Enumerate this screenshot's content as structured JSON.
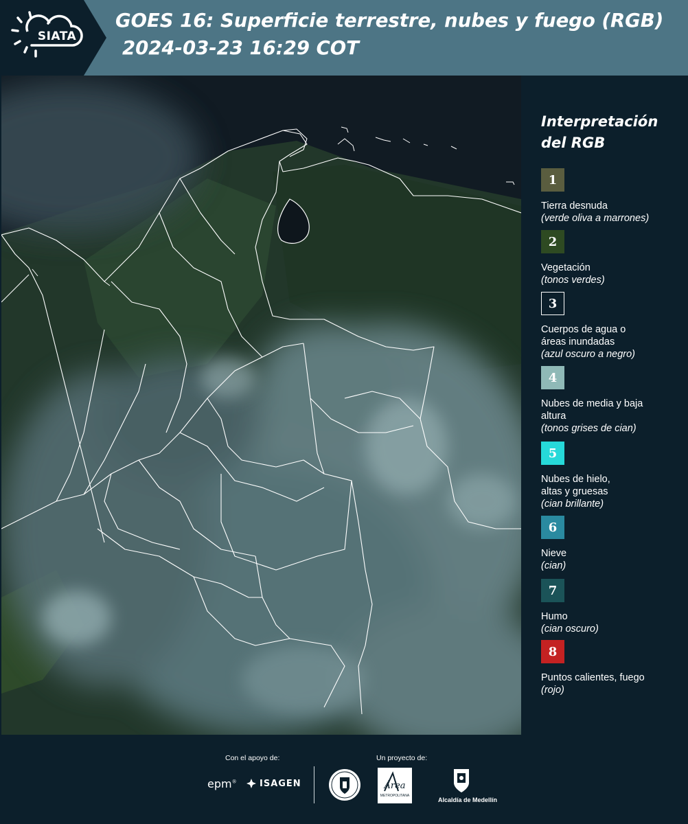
{
  "header": {
    "logo_text": "SIATA",
    "title_line1": "GOES 16: Superficie terrestre, nubes y fuego (RGB)",
    "title_line2": "2024-03-23 16:29 COT",
    "background_color": "#4d7585"
  },
  "legend": {
    "title_line1": "Interpretación",
    "title_line2": "del RGB",
    "items": [
      {
        "number": "1",
        "label": "Tierra desnuda",
        "note": "(verde oliva a marrones)",
        "color": "#5a5d3f"
      },
      {
        "number": "2",
        "label": "Vegetación",
        "note": "(tonos verdes)",
        "color": "#2e4a22"
      },
      {
        "number": "3",
        "label": "Cuerpos de agua o áreas inundadas",
        "note": "(azul oscuro a negro)",
        "color": "#0c1f2b"
      },
      {
        "number": "4",
        "label": "Nubes de media y baja altura",
        "note": "(tonos grises de cian)",
        "color": "#8fb9b7"
      },
      {
        "number": "5",
        "label": "Nubes de hielo, altas y gruesas",
        "note": "(cian brillante)",
        "color": "#26d9d9"
      },
      {
        "number": "6",
        "label": "Nieve",
        "note": "(cian)",
        "color": "#2a8aa0"
      },
      {
        "number": "7",
        "label": "Humo",
        "note": "(cian oscuro)",
        "color": "#1b5358"
      },
      {
        "number": "8",
        "label": "Puntos calientes, fuego",
        "note": "(rojo)",
        "color": "#c42222"
      }
    ]
  },
  "footer": {
    "support_label": "Con el apoyo de:",
    "project_label": "Un proyecto de:",
    "sponsor_1": "epm",
    "sponsor_2": "ISAGEN",
    "partner_3": "Área",
    "partner_3_sub": "METROPOLITANA",
    "partner_4": "Alcaldía de Medellín"
  }
}
